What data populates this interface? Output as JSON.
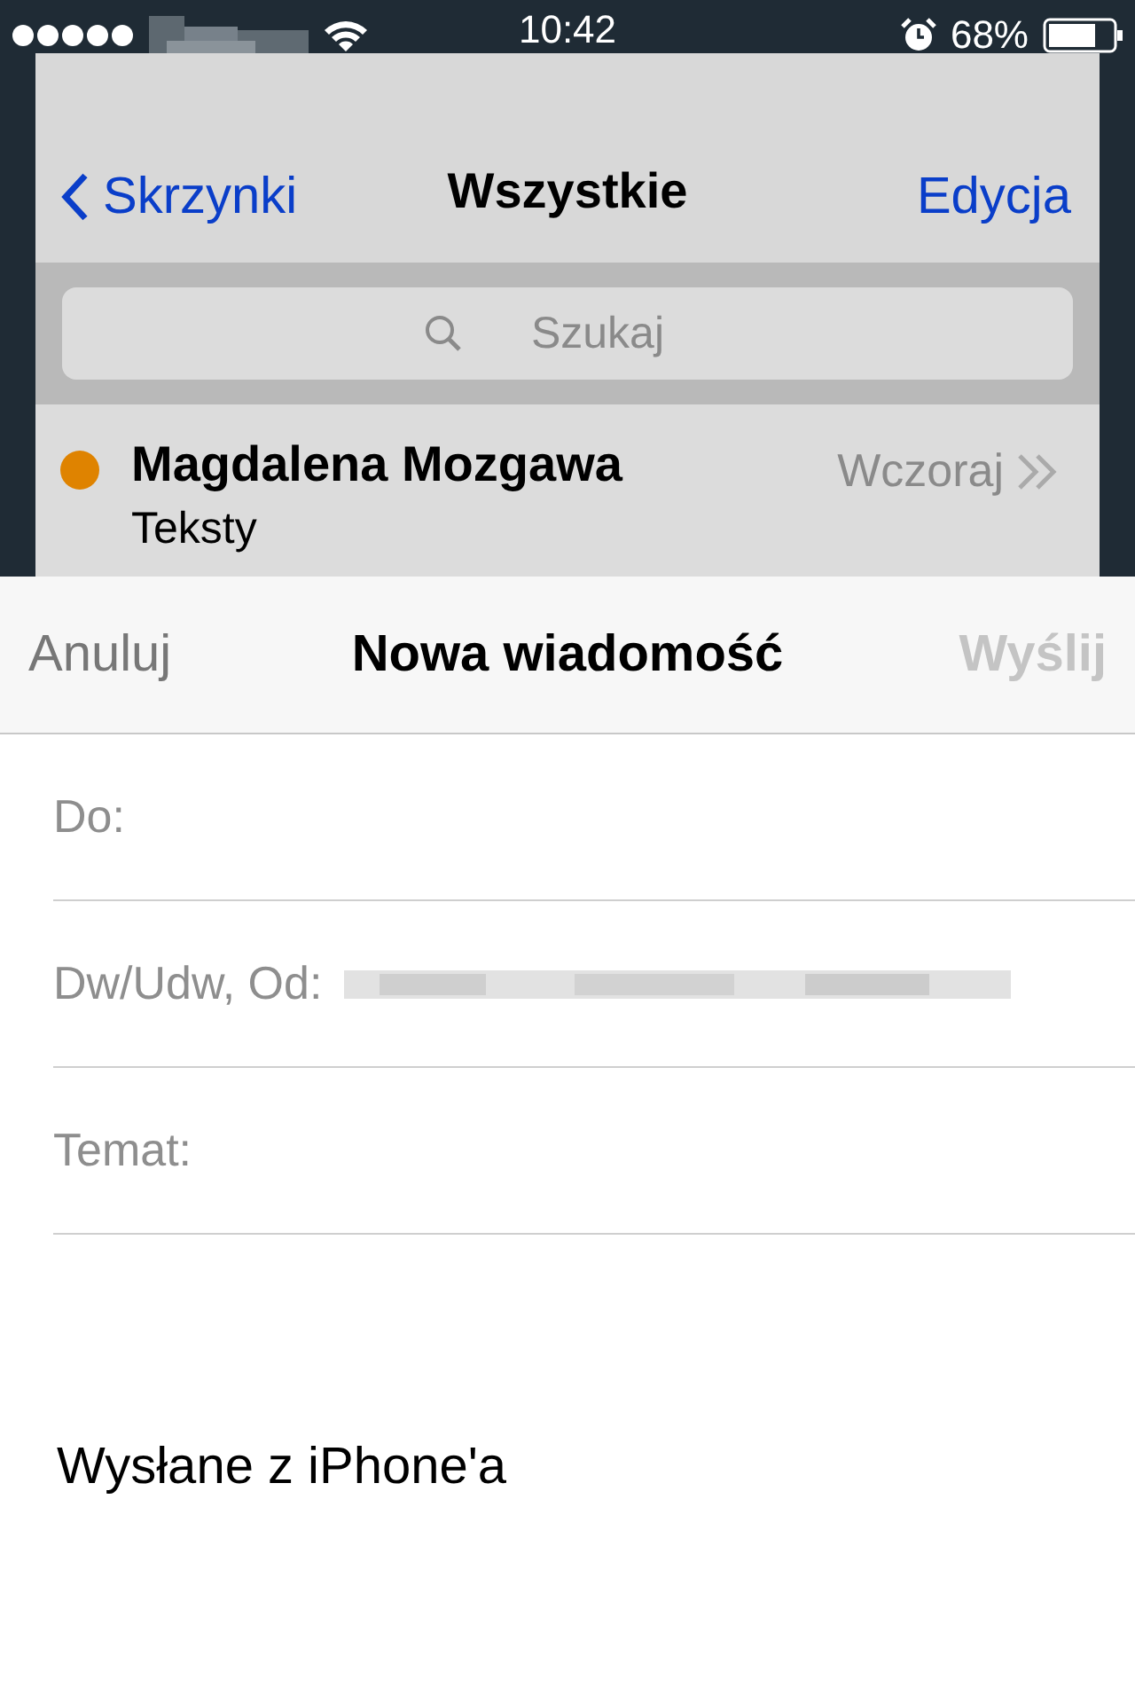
{
  "status_bar": {
    "time": "10:42",
    "battery": "68%"
  },
  "mailbox": {
    "back": "Skrzynki",
    "title": "Wszystkie",
    "edit": "Edycja",
    "search": {
      "placeholder": "Szukaj"
    },
    "messages": [
      {
        "sender": "Magdalena Mozgawa",
        "subject": "Teksty",
        "date": "Wczoraj",
        "unread": true
      }
    ]
  },
  "compose": {
    "cancel": "Anuluj",
    "title": "Nowa wiadomość",
    "send": {
      "label": "Wyślij",
      "disabled": true
    },
    "fields": [
      {
        "label": "Do:",
        "kind": "plain"
      },
      {
        "label": "Dw/Udw, Od:",
        "kind": "redacted"
      },
      {
        "label": "Temat:",
        "kind": "plain"
      }
    ],
    "signature": "Wysłane z iPhone'a"
  }
}
